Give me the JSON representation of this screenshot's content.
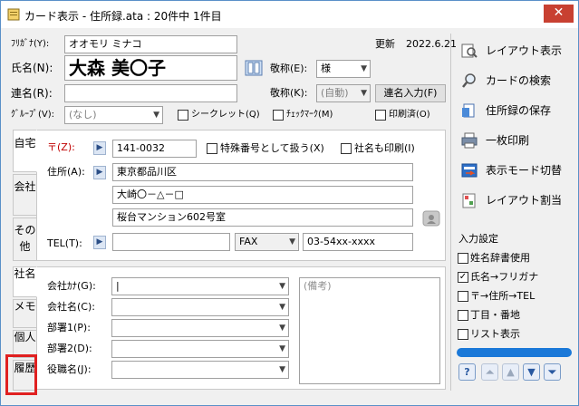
{
  "window": {
    "title": "カード表示 - 住所録.ata : 20件中 1件目",
    "close_label": "✕"
  },
  "header": {
    "furigana_label": "ﾌﾘｶﾞﾅ(Y):",
    "furigana_value": "オオモリ ミナコ",
    "updated_label": "更新",
    "updated_value": "2022.6.21",
    "name_label": "氏名(N):",
    "name_value": "大森 美〇子",
    "honorific_label": "敬称(E):",
    "honorific_value": "様",
    "joint_label": "連名(R):",
    "joint_value": "",
    "honorific2_label": "敬称(K):",
    "honorific2_value": "(自動)",
    "joint_button": "連名入力(F)",
    "group_label": "ｸﾞﾙｰﾌﾟ(V):",
    "group_value": "(なし)",
    "secret_label": "シークレット(Q)",
    "checkmark_label": "ﾁｪｯｸﾏｰｸ(M)",
    "printed_label": "印刷済(O)"
  },
  "tabs_top": [
    "自宅",
    "会社",
    "その他"
  ],
  "tabs_bottom": [
    "社名",
    "メモ",
    "個人",
    "履歴"
  ],
  "home": {
    "zip_label": "〒(Z):",
    "zip_value": "141-0032",
    "special_label": "特殊番号として扱う(X)",
    "company_print_label": "社名も印刷(I)",
    "address_label": "住所(A):",
    "address_lines": [
      "東京都品川区",
      "大崎〇－△－□",
      "桜台マンション602号室"
    ],
    "tel_label": "TEL(T):",
    "tel_value": "",
    "fax_type": "FAX",
    "fax_value": "03-54xx-xxxx"
  },
  "company": {
    "kana_label": "会社ｶﾅ(G):",
    "name_label": "会社名(C):",
    "dept1_label": "部署1(P):",
    "dept2_label": "部署2(D):",
    "title_label": "役職名(J):",
    "kana_value": "|",
    "name_value": "",
    "dept1_value": "",
    "dept2_value": "",
    "title_value": "",
    "note_placeholder": "(備考)"
  },
  "actions": [
    {
      "label": "レイアウト表示",
      "icon": "layout-view-icon"
    },
    {
      "label": "カードの検索",
      "icon": "search-icon"
    },
    {
      "label": "住所録の保存",
      "icon": "save-icon"
    },
    {
      "label": "一枚印刷",
      "icon": "printer-icon"
    },
    {
      "label": "表示モード切替",
      "icon": "display-mode-icon"
    },
    {
      "label": "レイアウト割当",
      "icon": "layout-assign-icon"
    }
  ],
  "input_settings": {
    "title": "入力設定",
    "options": [
      {
        "label": "姓名辞書使用",
        "checked": false
      },
      {
        "label": "氏名→フリガナ",
        "checked": true
      },
      {
        "label": "〒→住所→TEL",
        "checked": false
      },
      {
        "label": "丁目・番地",
        "checked": false
      },
      {
        "label": "リスト表示",
        "checked": false
      }
    ]
  },
  "nav": {
    "help": "?",
    "first": "⏶",
    "prev": "▲",
    "next": "▼",
    "last": "⏷"
  },
  "colors": {
    "highlight": "#e02020",
    "progress": "#1a78d8",
    "close": "#c84031"
  }
}
